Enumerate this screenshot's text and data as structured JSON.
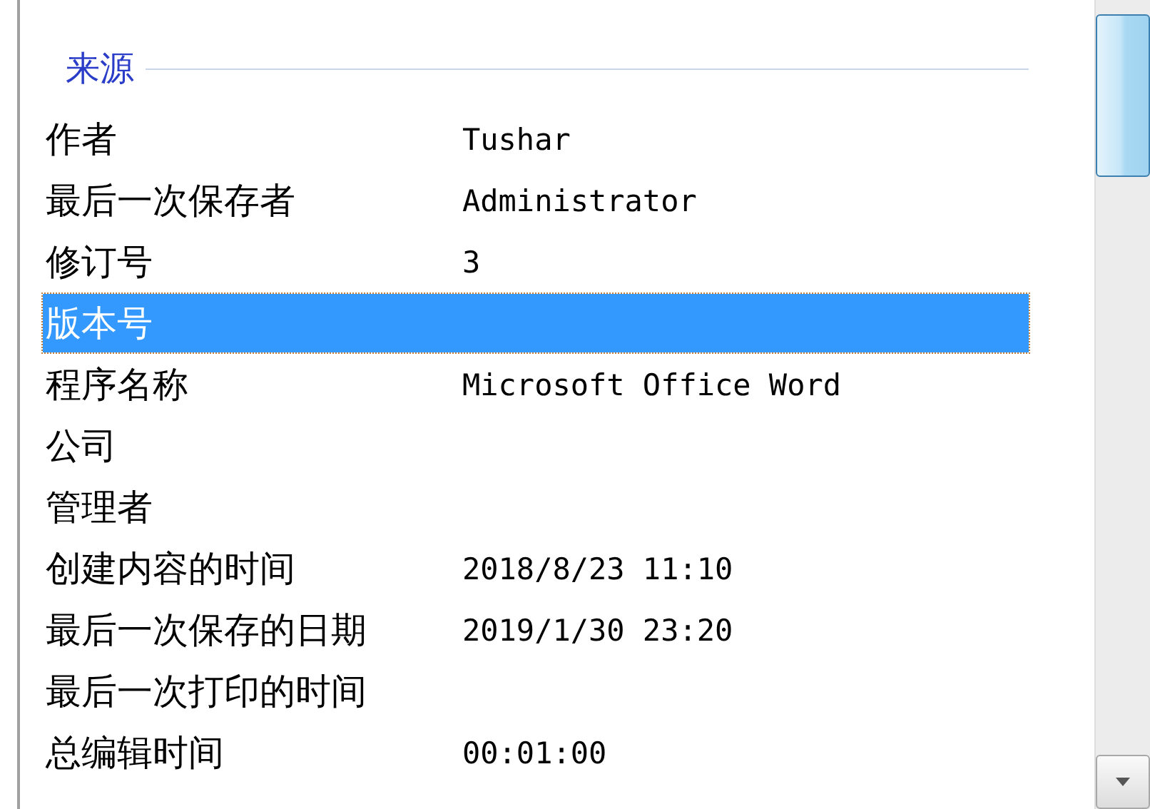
{
  "section": {
    "title": "来源"
  },
  "rows": [
    {
      "label": "作者",
      "value": "Tushar",
      "selected": false
    },
    {
      "label": "最后一次保存者",
      "value": "Administrator",
      "selected": false
    },
    {
      "label": "修订号",
      "value": "3",
      "selected": false
    },
    {
      "label": "版本号",
      "selected": true
    },
    {
      "label": "程序名称",
      "value": "Microsoft Office Word",
      "selected": false
    },
    {
      "label": "公司",
      "selected": false
    },
    {
      "label": "管理者",
      "selected": false
    },
    {
      "label": "创建内容的时间",
      "value": "2018/8/23 11:10",
      "selected": false
    },
    {
      "label": "最后一次保存的日期",
      "value": "2019/1/30 23:20",
      "selected": false
    },
    {
      "label": "最后一次打印的时间",
      "selected": false
    },
    {
      "label": "总编辑时间",
      "value": "00:01:00",
      "selected": false
    }
  ]
}
